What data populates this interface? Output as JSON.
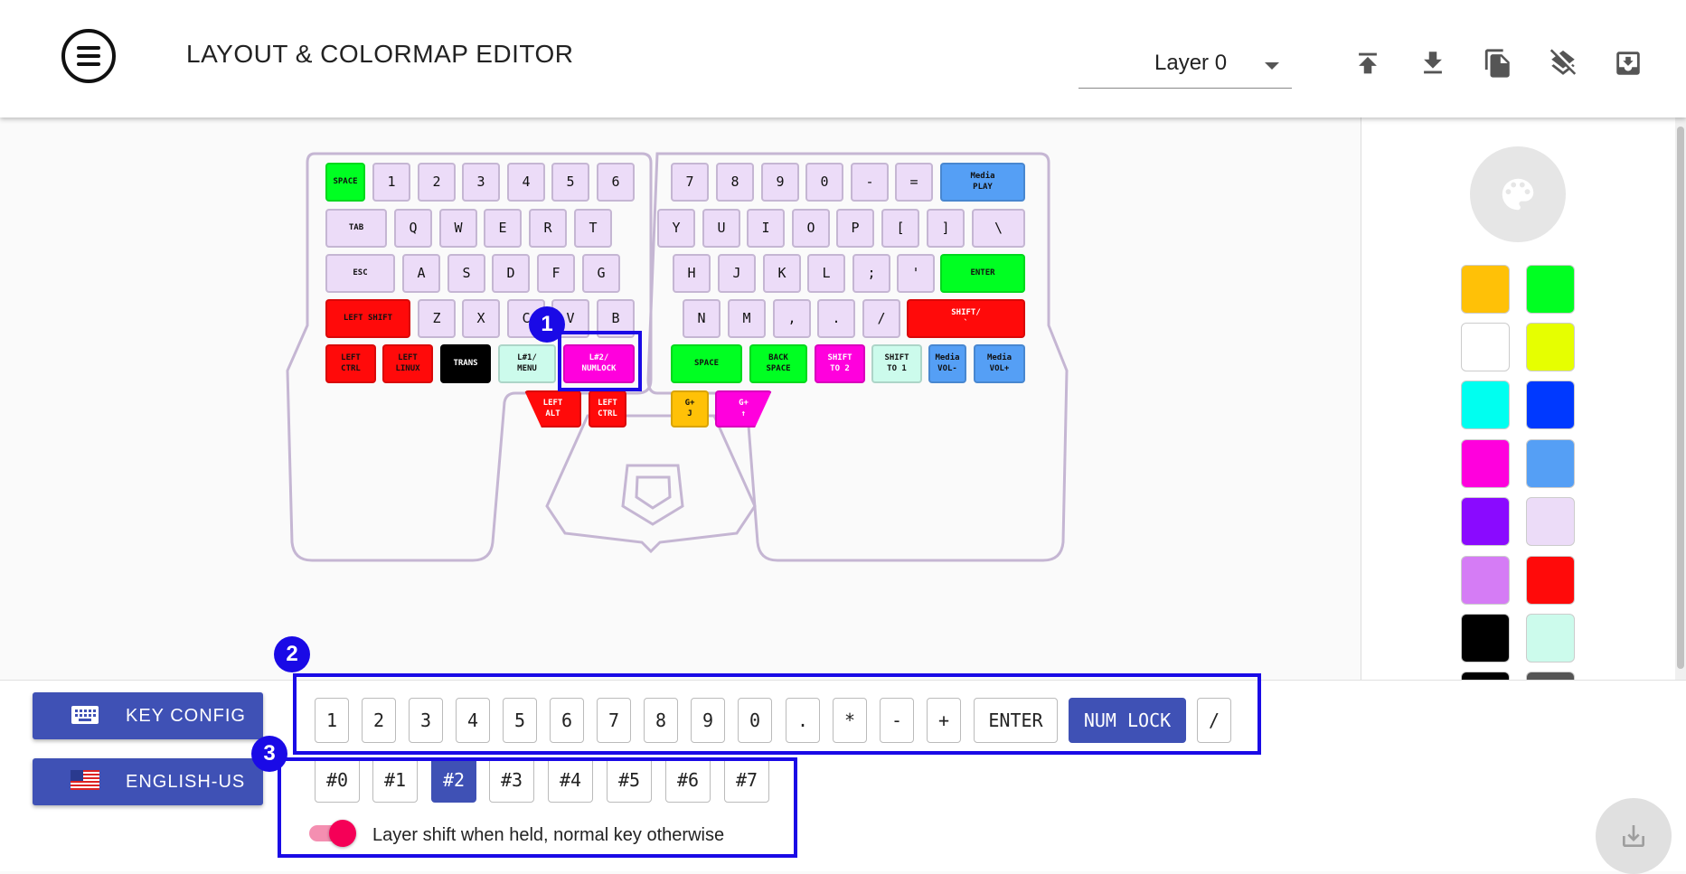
{
  "header": {
    "title": "LAYOUT & COLORMAP EDITOR",
    "layer_select": "Layer 0",
    "icons": [
      "upload-icon",
      "download-icon",
      "copy-icon",
      "clear-layer-icon",
      "archive-icon"
    ]
  },
  "keyboard": {
    "keys": [
      {
        "label": "SPACE",
        "color": "#00ff22"
      },
      {
        "label": "1",
        "color": "#ecdcf8"
      },
      {
        "label": "2",
        "color": "#ecdcf8"
      },
      {
        "label": "3",
        "color": "#ecdcf8"
      },
      {
        "label": "4",
        "color": "#ecdcf8"
      },
      {
        "label": "5",
        "color": "#ecdcf8"
      },
      {
        "label": "6",
        "color": "#ecdcf8"
      },
      {
        "label": "TAB",
        "color": "#ecdcf8"
      },
      {
        "label": "Q",
        "color": "#ecdcf8"
      },
      {
        "label": "W",
        "color": "#ecdcf8"
      },
      {
        "label": "E",
        "color": "#ecdcf8"
      },
      {
        "label": "R",
        "color": "#ecdcf8"
      },
      {
        "label": "T",
        "color": "#ecdcf8"
      },
      {
        "label": "ESC",
        "color": "#ecdcf8"
      },
      {
        "label": "A",
        "color": "#ecdcf8"
      },
      {
        "label": "S",
        "color": "#ecdcf8"
      },
      {
        "label": "D",
        "color": "#ecdcf8"
      },
      {
        "label": "F",
        "color": "#ecdcf8"
      },
      {
        "label": "G",
        "color": "#ecdcf8"
      },
      {
        "label": "LEFT SHIFT",
        "color": "#ff0a0a"
      },
      {
        "label": "Z",
        "color": "#ecdcf8"
      },
      {
        "label": "X",
        "color": "#ecdcf8"
      },
      {
        "label": "C",
        "color": "#ecdcf8"
      },
      {
        "label": "V",
        "color": "#ecdcf8"
      },
      {
        "label": "B",
        "color": "#ecdcf8"
      },
      {
        "label": "LEFT\nCTRL",
        "color": "#ff0a0a"
      },
      {
        "label": "LEFT\nLINUX",
        "color": "#ff0a0a"
      },
      {
        "label": "TRANS",
        "color": "#000000"
      },
      {
        "label": "L#1/\nMENU",
        "color": "#ccfbec"
      },
      {
        "label": "L#2/\nNUMLOCK",
        "color": "#ff00dd"
      },
      {
        "label": "LEFT\nALT",
        "color": "#ff0a0a"
      },
      {
        "label": "LEFT\nCTRL",
        "color": "#ff0a0a"
      },
      {
        "label": "7",
        "color": "#ecdcf8"
      },
      {
        "label": "8",
        "color": "#ecdcf8"
      },
      {
        "label": "9",
        "color": "#ecdcf8"
      },
      {
        "label": "0",
        "color": "#ecdcf8"
      },
      {
        "label": "-",
        "color": "#ecdcf8"
      },
      {
        "label": "=",
        "color": "#ecdcf8"
      },
      {
        "label": "Media\nPLAY",
        "color": "#559ff5"
      },
      {
        "label": "Y",
        "color": "#ecdcf8"
      },
      {
        "label": "U",
        "color": "#ecdcf8"
      },
      {
        "label": "I",
        "color": "#ecdcf8"
      },
      {
        "label": "O",
        "color": "#ecdcf8"
      },
      {
        "label": "P",
        "color": "#ecdcf8"
      },
      {
        "label": "[",
        "color": "#ecdcf8"
      },
      {
        "label": "]",
        "color": "#ecdcf8"
      },
      {
        "label": "\\",
        "color": "#ecdcf8"
      },
      {
        "label": "H",
        "color": "#ecdcf8"
      },
      {
        "label": "J",
        "color": "#ecdcf8"
      },
      {
        "label": "K",
        "color": "#ecdcf8"
      },
      {
        "label": "L",
        "color": "#ecdcf8"
      },
      {
        "label": ";",
        "color": "#ecdcf8"
      },
      {
        "label": "'",
        "color": "#ecdcf8"
      },
      {
        "label": "ENTER",
        "color": "#00ff22"
      },
      {
        "label": "N",
        "color": "#ecdcf8"
      },
      {
        "label": "M",
        "color": "#ecdcf8"
      },
      {
        "label": ",",
        "color": "#ecdcf8"
      },
      {
        "label": ".",
        "color": "#ecdcf8"
      },
      {
        "label": "/",
        "color": "#ecdcf8"
      },
      {
        "label": "SHIFT/\n`",
        "color": "#ff0a0a"
      },
      {
        "label": "SPACE",
        "color": "#00ff22"
      },
      {
        "label": "BACK\nSPACE",
        "color": "#00ff22"
      },
      {
        "label": "SHIFT\nTO 2",
        "color": "#ff00dd"
      },
      {
        "label": "SHIFT\nTO 1",
        "color": "#ccfbec"
      },
      {
        "label": "Media\nVOL-",
        "color": "#559ff5"
      },
      {
        "label": "Media\nVOL+",
        "color": "#559ff5"
      },
      {
        "label": "G+\nJ",
        "color": "#ffc107"
      },
      {
        "label": "G+\n↑",
        "color": "#ff00dd"
      }
    ]
  },
  "palette": {
    "colors": [
      "#ffc107",
      "#00ff22",
      "#ffffff",
      "#e6ff00",
      "#00fff0",
      "#0039ff",
      "#ff00dd",
      "#559ff5",
      "#8a0aff",
      "#ecdcf8",
      "#d57cf5",
      "#ff0a0a",
      "#000000",
      "#ccfbec",
      "#000000",
      "#555555"
    ]
  },
  "bottom": {
    "key_config_label": "KEY CONFIG",
    "language_label": "ENGLISH-US",
    "numpad_keys": [
      "1",
      "2",
      "3",
      "4",
      "5",
      "6",
      "7",
      "8",
      "9",
      "0",
      ".",
      "*",
      "-",
      "+",
      "ENTER",
      "NUM LOCK",
      "/"
    ],
    "numpad_active": "NUM LOCK",
    "layers": [
      "#0",
      "#1",
      "#2",
      "#3",
      "#4",
      "#5",
      "#6",
      "#7"
    ],
    "layer_active": "#2",
    "toggle_label": "Layer shift when held, normal key otherwise",
    "toggle_on": true
  },
  "badges": [
    "1",
    "2",
    "3"
  ]
}
